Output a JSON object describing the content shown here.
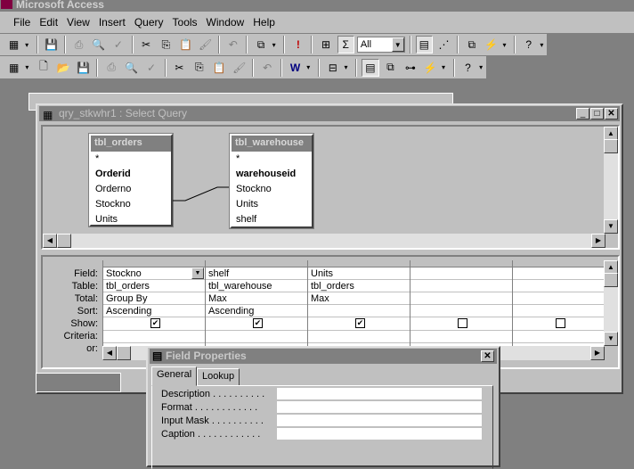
{
  "app": {
    "title": "Microsoft Access"
  },
  "menu": [
    "File",
    "Edit",
    "View",
    "Insert",
    "Query",
    "Tools",
    "Window",
    "Help"
  ],
  "toolbar1": {
    "combo_value": "All",
    "icons": [
      "view-icon",
      "save-icon",
      "print-icon",
      "print-preview-icon",
      "spelling-icon",
      "cut-icon",
      "copy-icon",
      "paste-icon",
      "format-painter-icon",
      "undo-icon",
      "query-type-icon",
      "run-icon",
      "show-table-icon",
      "totals-icon",
      "properties-icon",
      "build-icon",
      "database-window-icon",
      "new-object-icon",
      "help-icon"
    ]
  },
  "toolbar2": {
    "icons": [
      "view-icon",
      "new-icon",
      "open-icon",
      "save-icon",
      "print-icon",
      "print-preview-icon",
      "spelling-icon",
      "cut-icon",
      "copy-icon",
      "paste-icon",
      "format-painter-icon",
      "undo-icon",
      "office-links-icon",
      "analyze-icon",
      "properties-icon",
      "database-window-icon",
      "relationships-icon",
      "new-object-icon",
      "help-icon"
    ]
  },
  "query_window": {
    "title": "qry_stkwhr1 : Select Query"
  },
  "tables": [
    {
      "name": "tbl_orders",
      "fields": [
        "*",
        "Orderid",
        "Orderno",
        "Stockno",
        "Units"
      ],
      "key": "Orderid"
    },
    {
      "name": "tbl_warehouse",
      "fields": [
        "*",
        "warehouseid",
        "Stockno",
        "Units",
        "shelf"
      ],
      "key": "warehouseid"
    }
  ],
  "grid": {
    "row_labels": [
      "Field:",
      "Table:",
      "Total:",
      "Sort:",
      "Show:",
      "Criteria:",
      "or:"
    ],
    "columns": [
      {
        "field": "Stockno",
        "table": "tbl_orders",
        "total": "Group By",
        "sort": "Ascending",
        "show": true
      },
      {
        "field": "shelf",
        "table": "tbl_warehouse",
        "total": "Max",
        "sort": "Ascending",
        "show": true
      },
      {
        "field": "Units",
        "table": "tbl_orders",
        "total": "Max",
        "sort": "",
        "show": true
      },
      {
        "field": "",
        "table": "",
        "total": "",
        "sort": "",
        "show": false
      },
      {
        "field": "",
        "table": "",
        "total": "",
        "sort": "",
        "show": false
      }
    ]
  },
  "field_properties": {
    "title": "Field Properties",
    "tabs": [
      "General",
      "Lookup"
    ],
    "rows": [
      {
        "label": "Description . . . . . . . . . .",
        "value": ""
      },
      {
        "label": "Format . . . . . . . . . . . .",
        "value": ""
      },
      {
        "label": "Input Mask . . . . . . . . . .",
        "value": ""
      },
      {
        "label": "Caption . . . . . . . . . . . .",
        "value": ""
      }
    ]
  }
}
